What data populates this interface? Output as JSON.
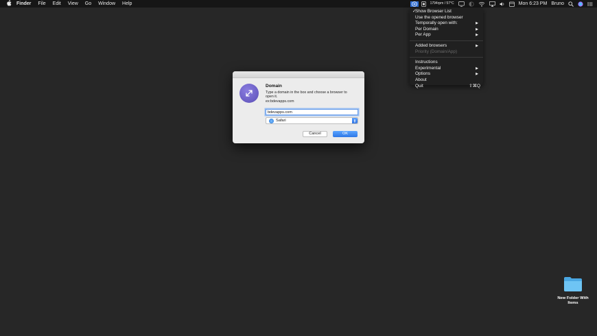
{
  "menubar": {
    "apple_icon": "apple-icon",
    "items": [
      {
        "label": "Finder",
        "bold": true
      },
      {
        "label": "File"
      },
      {
        "label": "Edit"
      },
      {
        "label": "View"
      },
      {
        "label": "Go"
      },
      {
        "label": "Window"
      },
      {
        "label": "Help"
      }
    ],
    "status": {
      "fan_temp": "1794rpm / 57°C",
      "clock": "Mon 6:23 PM",
      "user": "Bruno"
    }
  },
  "dropdown": {
    "items": [
      {
        "label": "Show Browser List",
        "checked": true
      },
      {
        "label": "Use the opened browser"
      },
      {
        "label": "Temporally open with:",
        "submenu": true
      },
      {
        "label": "Per Domain",
        "submenu": true
      },
      {
        "label": "Per App",
        "submenu": true
      },
      {
        "separator": true
      },
      {
        "label": "Added browsers",
        "submenu": true
      },
      {
        "label": "Priority (Domain/App)",
        "disabled": true
      },
      {
        "separator": true
      },
      {
        "label": "Instructions"
      },
      {
        "label": "Experimental",
        "submenu": true
      },
      {
        "label": "Options",
        "submenu": true
      },
      {
        "label": "About"
      },
      {
        "label": "Quit",
        "shortcut": "⇧⌘Q"
      }
    ]
  },
  "dialog": {
    "title": "Domain",
    "message": "Type a domain in the box and choose a browser to open it.",
    "example": "ex:bdevapps.com",
    "input_value": "bdevapps.com",
    "selected_browser": "Safari",
    "cancel_label": "Cancel",
    "ok_label": "OK"
  },
  "desktop": {
    "folder_label": "New Folder With Items"
  },
  "colors": {
    "desktop": "#272727",
    "accent": "#2f78e6",
    "folder": "#5ab7ee"
  }
}
